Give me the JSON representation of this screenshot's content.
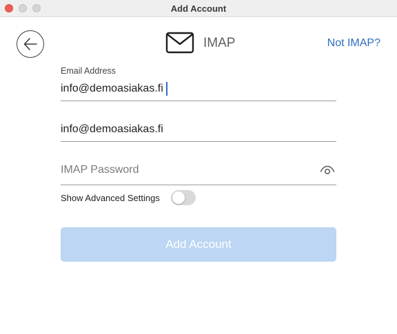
{
  "window": {
    "title": "Add Account"
  },
  "header": {
    "label": "IMAP",
    "icon": "envelope-icon",
    "switch_link": "Not IMAP?",
    "back_icon": "arrow-left-icon"
  },
  "form": {
    "email_label": "Email Address",
    "email_value": "info@demoasiakas.fi",
    "username_value": "info@demoasiakas.fi",
    "password_placeholder": "IMAP Password",
    "password_value": "",
    "reveal_icon": "eye-icon",
    "advanced_label": "Show Advanced Settings",
    "advanced_enabled": false
  },
  "actions": {
    "submit_label": "Add Account"
  },
  "colors": {
    "accent": "#2f6cc0",
    "button_disabled": "#bcd6f3",
    "close": "#ec5f57",
    "toggle_off": "#d9d9d9"
  }
}
